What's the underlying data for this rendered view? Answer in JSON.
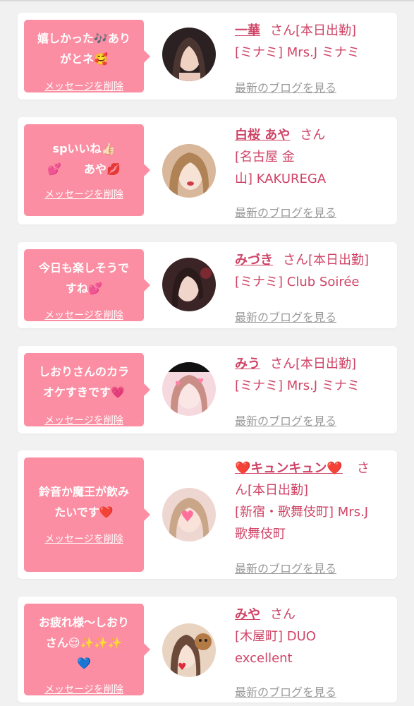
{
  "colors": {
    "accent": "#fc8ea3",
    "name_text": "#cf4466",
    "link_gray": "#9a9a9a",
    "background": "#f1f1f1"
  },
  "delete_label": "メッセージを削除",
  "blog_label": "最新のブログを見る",
  "messages": [
    {
      "text": "嬉しかった🎶あり\nがとネ🥰",
      "name": "一華",
      "honorific_status": "さん[本日出勤]",
      "shop": "[ミナミ] Mrs.J ミナミ"
    },
    {
      "text": "spいいね👍🏻\n💕　　あや💋",
      "name": "白桜 あや",
      "honorific_status": "さん",
      "shop": "[名古屋 金\n山] KAKUREGA"
    },
    {
      "text": "今日も楽しそうで\nすね💕",
      "name": "みづき",
      "honorific_status": "さん[本日出勤]",
      "shop": "[ミナミ] Club Soirée"
    },
    {
      "text": "しおりさんのカラ\nオケすきです💗",
      "name": "みう",
      "honorific_status": "さん[本日出勤]",
      "shop": "[ミナミ] Mrs.J ミナミ"
    },
    {
      "text": "鈴音か魔王が飲み\nたいです❤️",
      "name": "❤️キュンキュン❤️",
      "honorific_status": "さ\nん[本日出勤]",
      "shop": "[新宿・歌舞伎町] Mrs.J\n歌舞伎町"
    },
    {
      "text": "お疲れ様〜しおり\nさん😌✨✨✨\n💙",
      "name": "みや",
      "honorific_status": "さん",
      "shop": "[木屋町] DUO\nexcellent"
    }
  ]
}
